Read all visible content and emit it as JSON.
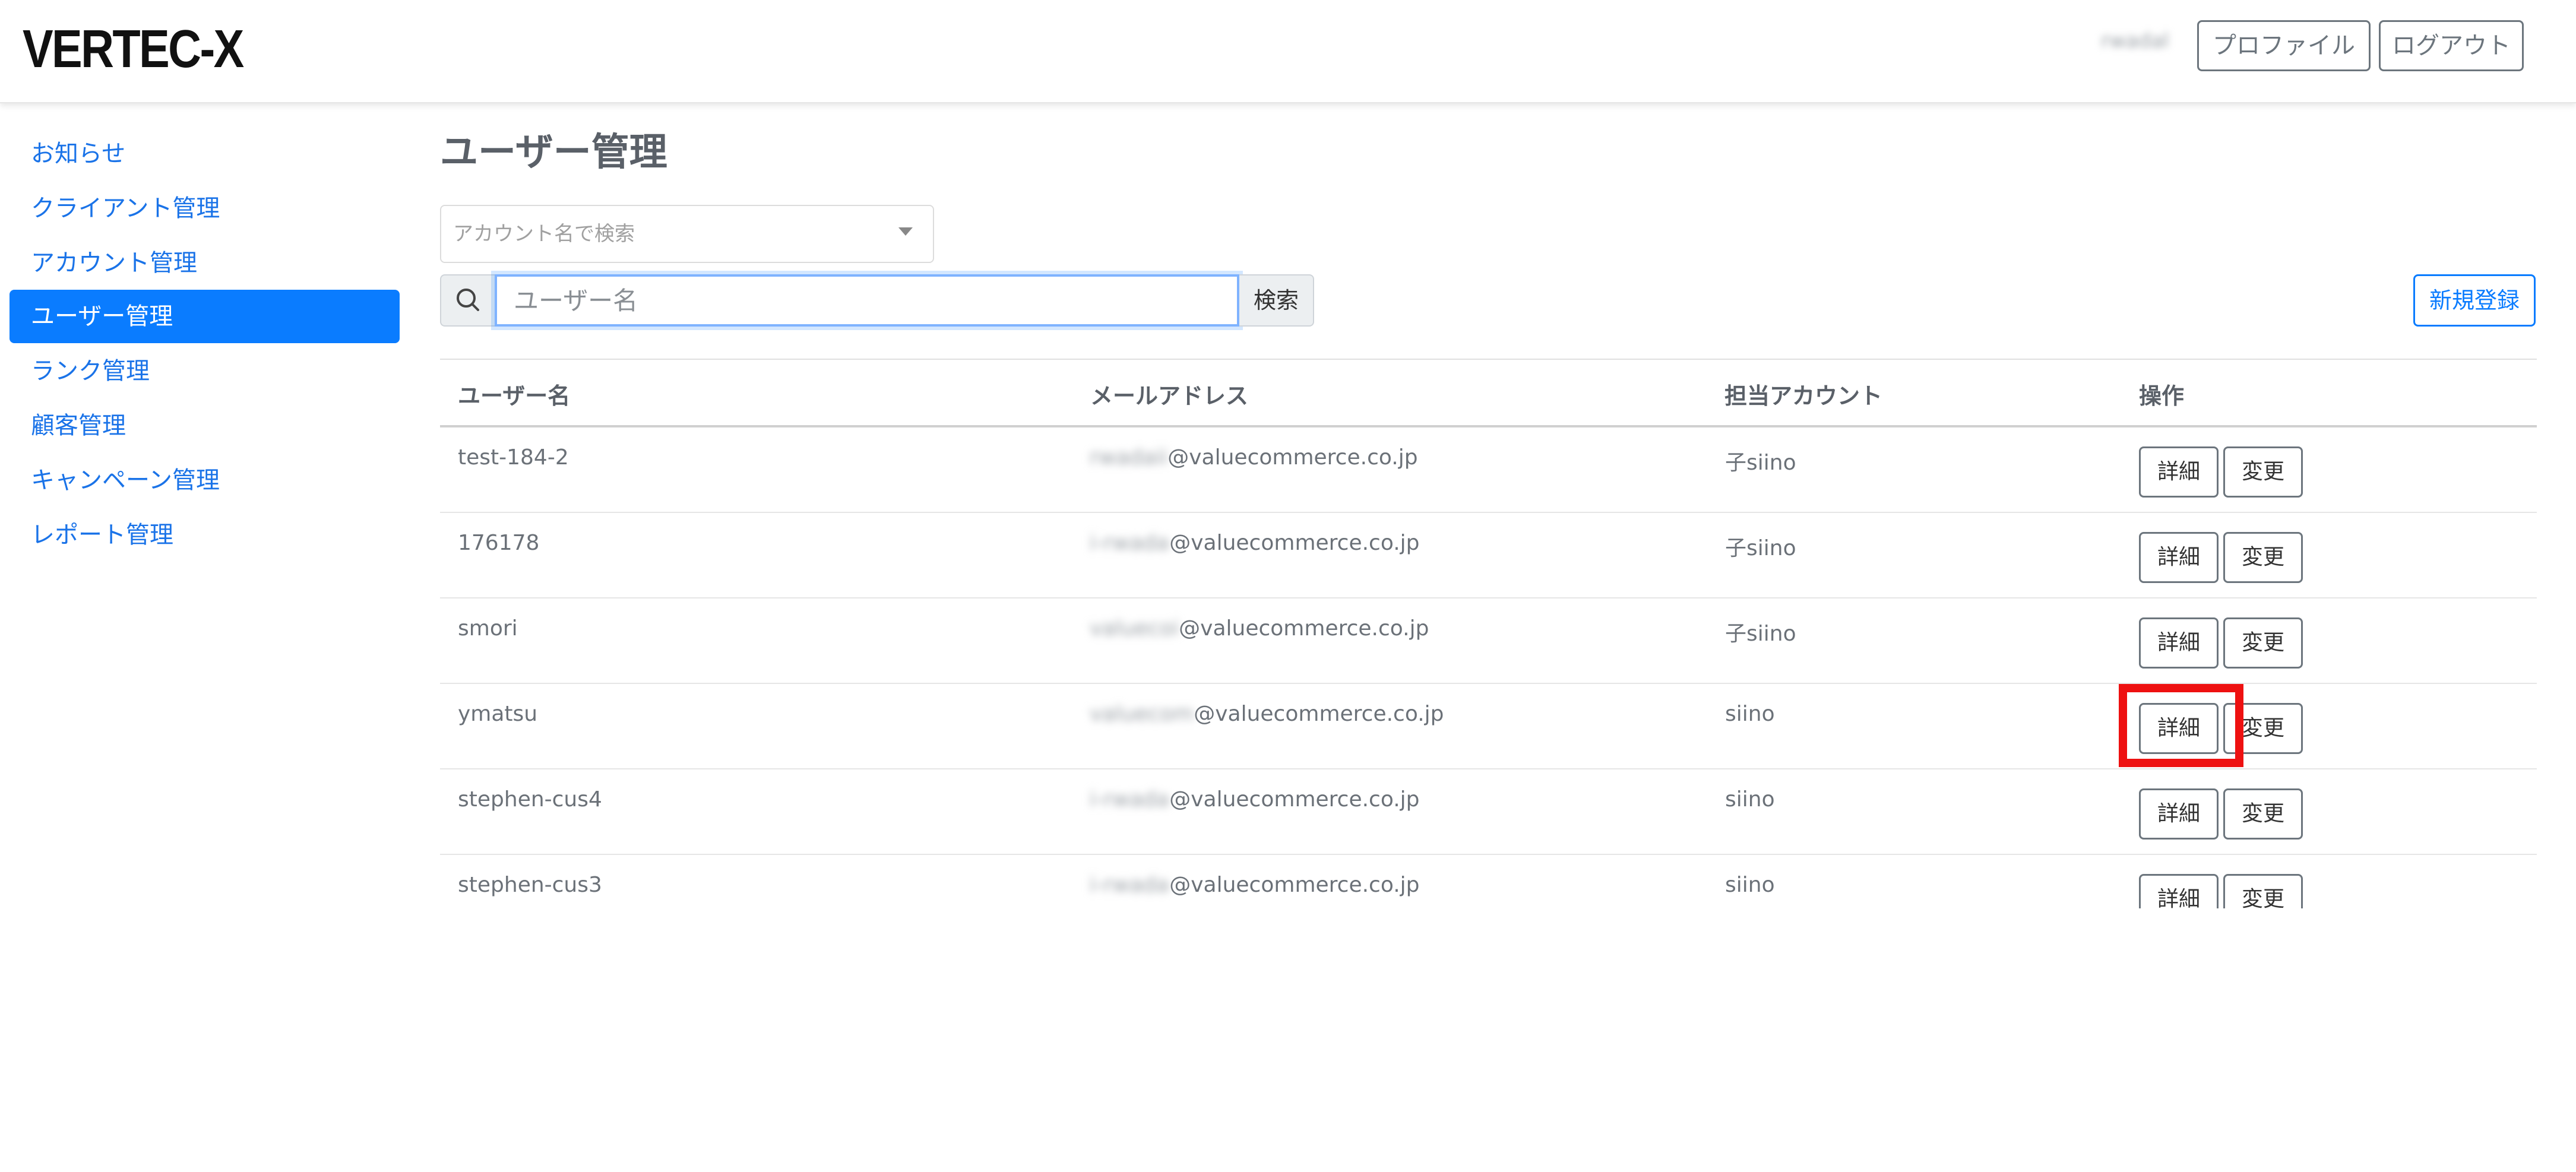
{
  "header": {
    "logo": "VERTEC-X",
    "username": "rwadal",
    "profile_label": "プロファイル",
    "logout_label": "ログアウト"
  },
  "sidebar": {
    "items": [
      {
        "label": "お知らせ",
        "active": false
      },
      {
        "label": "クライアント管理",
        "active": false
      },
      {
        "label": "アカウント管理",
        "active": false
      },
      {
        "label": "ユーザー管理",
        "active": true
      },
      {
        "label": "ランク管理",
        "active": false
      },
      {
        "label": "顧客管理",
        "active": false
      },
      {
        "label": "キャンペーン管理",
        "active": false
      },
      {
        "label": "レポート管理",
        "active": false
      }
    ]
  },
  "main": {
    "title": "ユーザー管理",
    "account_select_placeholder": "アカウント名で検索",
    "search_placeholder": "ユーザー名",
    "search_button": "検索",
    "new_button": "新規登録"
  },
  "table": {
    "headers": [
      "ユーザー名",
      "メールアドレス",
      "担当アカウント",
      "操作"
    ],
    "detail_label": "詳細",
    "edit_label": "変更",
    "rows": [
      {
        "username": "test-184-2",
        "email_blur": "rwadaii",
        "email_domain": "@valuecommerce.co.jp",
        "account": "子siino"
      },
      {
        "username": "176178",
        "email_blur": "i-rwada",
        "email_domain": "@valuecommerce.co.jp",
        "account": "子siino"
      },
      {
        "username": "smori",
        "email_blur": "valuecoi",
        "email_domain": "@valuecommerce.co.jp",
        "account": "子siino"
      },
      {
        "username": "ymatsu",
        "email_blur": "valuecom",
        "email_domain": "@valuecommerce.co.jp",
        "account": "siino"
      },
      {
        "username": "stephen-cus4",
        "email_blur": "i-rwada",
        "email_domain": "@valuecommerce.co.jp",
        "account": "siino"
      },
      {
        "username": "stephen-cus3",
        "email_blur": "i-rwada",
        "email_domain": "@valuecommerce.co.jp",
        "account": "siino"
      }
    ]
  },
  "colors": {
    "accent": "#0a7cff",
    "link": "#1a73e8",
    "highlight": "#ee1111"
  }
}
